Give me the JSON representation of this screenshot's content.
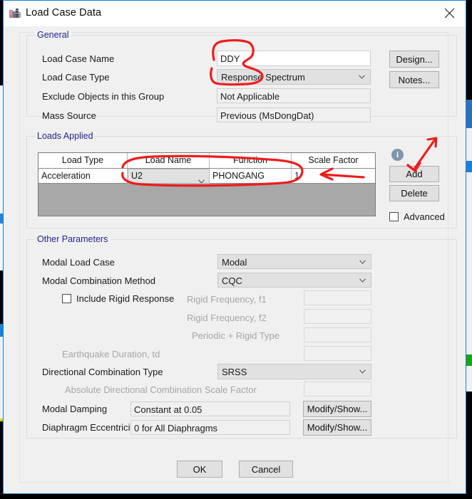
{
  "window": {
    "title": "Load Case Data",
    "icon": "building-icon",
    "close_icon": "close-icon"
  },
  "general": {
    "legend": "General",
    "fields": [
      {
        "label": "Load Case Name",
        "value": "DDY",
        "kind": "textbox"
      },
      {
        "label": "Load Case Type",
        "value": "Response Spectrum",
        "kind": "combo"
      },
      {
        "label": "Exclude Objects in this Group",
        "value": "Not Applicable",
        "kind": "readonly"
      },
      {
        "label": "Mass Source",
        "value": "Previous  (MsDongDat)",
        "kind": "readonly"
      }
    ],
    "buttons": [
      {
        "label": "Design...",
        "name": "design-button"
      },
      {
        "label": "Notes...",
        "name": "notes-button"
      }
    ]
  },
  "loads_applied": {
    "legend": "Loads Applied",
    "info_icon": "info-icon",
    "columns": [
      "Load Type",
      "Load Name",
      "Function",
      "Scale Factor"
    ],
    "rows": [
      {
        "load_type": "Acceleration",
        "load_name": "U2",
        "function": "PHONGANG",
        "scale_factor": "1"
      }
    ],
    "buttons": [
      {
        "label": "Add",
        "name": "add-button"
      },
      {
        "label": "Delete",
        "name": "delete-button"
      }
    ],
    "advanced": {
      "label": "Advanced",
      "checked": false
    }
  },
  "other_parameters": {
    "legend": "Other Parameters",
    "modal_load_case": {
      "label": "Modal Load Case",
      "value": "Modal"
    },
    "modal_combination_method": {
      "label": "Modal Combination Method",
      "value": "CQC"
    },
    "include_rigid_response": {
      "label": "Include Rigid Response",
      "checked": false
    },
    "rigid_frequency_f1": {
      "label": "Rigid Frequency, f1",
      "value": "",
      "disabled": true
    },
    "rigid_frequency_f2": {
      "label": "Rigid Frequency, f2",
      "value": "",
      "disabled": true
    },
    "periodic_rigid_type": {
      "label": "Periodic + Rigid Type",
      "value": "",
      "disabled": true
    },
    "earthquake_duration": {
      "label": "Earthquake Duration, td",
      "value": "",
      "disabled": true
    },
    "directional_combination_type": {
      "label": "Directional Combination Type",
      "value": "SRSS"
    },
    "absolute_directional_scale": {
      "label": "Absolute Directional Combination Scale Factor",
      "value": "",
      "disabled": true
    },
    "modal_damping": {
      "label": "Modal Damping",
      "value": "Constant at 0.05",
      "button": "Modify/Show..."
    },
    "diaphragm_eccentricity": {
      "label": "Diaphragm Eccentricity",
      "value": "0 for All Diaphragms",
      "button": "Modify/Show..."
    }
  },
  "footer": {
    "ok_label": "OK",
    "cancel_label": "Cancel"
  },
  "annotations": {
    "color": "#ee1c1c",
    "marks": [
      "circle-around-load-case-name-and-type",
      "arrow-pointing-to-add-button",
      "circle-around-load-row",
      "arrow-pointing-to-load-row"
    ]
  }
}
